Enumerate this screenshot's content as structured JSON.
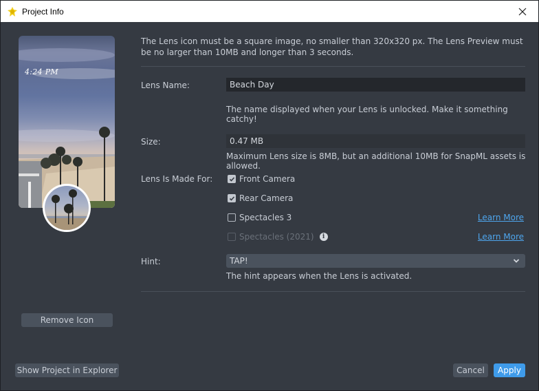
{
  "window": {
    "title": "Project Info",
    "close_icon": "close-icon",
    "app_icon": "snap-lens-studio-icon"
  },
  "preview": {
    "time_text": "4:24 PM",
    "remove_icon_label": "Remove Icon"
  },
  "footer": {
    "show_in_explorer_label": "Show Project in Explorer",
    "cancel_label": "Cancel",
    "apply_label": "Apply",
    "apply_color": "#3f9bea"
  },
  "form": {
    "intro": "The Lens icon must be a square image, no smaller than 320x320 px. The Lens Preview must be no larger than 10MB and longer than 3 seconds.",
    "lens_name": {
      "label": "Lens Name:",
      "value": "Beach Day",
      "help": "The name displayed when your Lens is unlocked. Make it something catchy!"
    },
    "size": {
      "label": "Size:",
      "value": "0.47 MB",
      "help": "Maximum Lens size is 8MB, but an additional 10MB for SnapML assets is allowed."
    },
    "made_for": {
      "label": "Lens Is Made For:",
      "options": [
        {
          "label": "Front Camera",
          "checked": true,
          "enabled": true
        },
        {
          "label": "Rear Camera",
          "checked": true,
          "enabled": true
        },
        {
          "label": "Spectacles 3",
          "checked": false,
          "enabled": true,
          "link": "Learn More"
        },
        {
          "label": "Spectacles (2021)",
          "checked": false,
          "enabled": false,
          "link": "Learn More",
          "info_icon": "info-icon"
        }
      ]
    },
    "hint": {
      "label": "Hint:",
      "selected": "TAP!",
      "help": "The hint appears when the Lens is activated."
    },
    "link_color": "#4ea6ee"
  }
}
